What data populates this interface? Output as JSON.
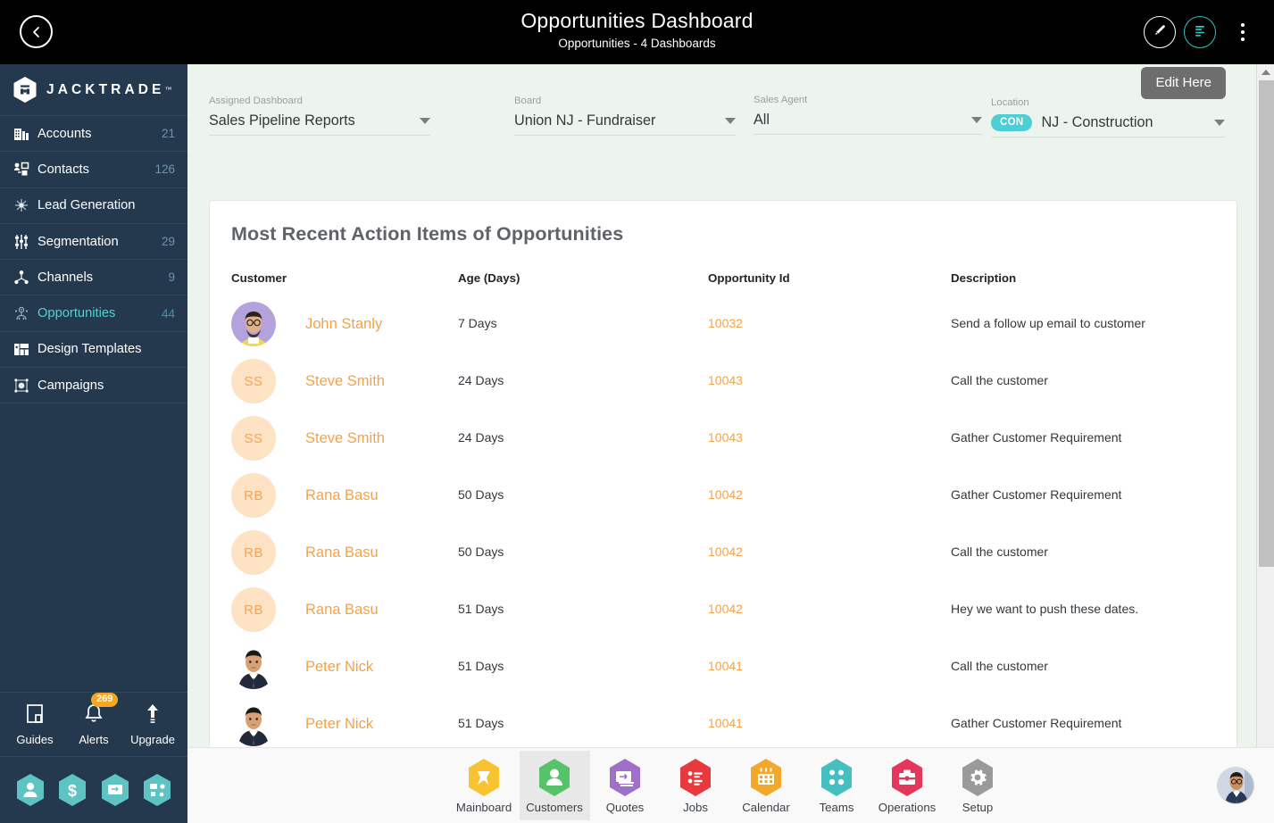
{
  "topbar": {
    "back_icon": "chevron-left-icon",
    "title": "Opportunities Dashboard",
    "subtitle": "Opportunities - 4 Dashboards",
    "edit_icon": "pencil-icon",
    "list_icon": "list-lines-icon",
    "more_icon": "kebab-menu-icon"
  },
  "sidebar": {
    "brand": "JACKTRADE",
    "brand_tm": "™",
    "items": [
      {
        "label": "Accounts",
        "count": "21",
        "icon": "building-icon",
        "active": false
      },
      {
        "label": "Contacts",
        "count": "126",
        "icon": "contacts-icon",
        "active": false
      },
      {
        "label": "Lead Generation",
        "count": "",
        "icon": "lead-gen-icon",
        "active": false
      },
      {
        "label": "Segmentation",
        "count": "29",
        "icon": "segmentation-icon",
        "active": false
      },
      {
        "label": "Channels",
        "count": "9",
        "icon": "channels-icon",
        "active": false
      },
      {
        "label": "Opportunities",
        "count": "44",
        "icon": "opportunities-icon",
        "active": true
      },
      {
        "label": "Design Templates",
        "count": "",
        "icon": "templates-icon",
        "active": false
      },
      {
        "label": "Campaigns",
        "count": "",
        "icon": "campaigns-icon",
        "active": false
      }
    ],
    "tools": [
      {
        "label": "Guides",
        "icon": "book-icon",
        "badge": ""
      },
      {
        "label": "Alerts",
        "icon": "bell-icon",
        "badge": "269"
      },
      {
        "label": "Upgrade",
        "icon": "arrow-up-icon",
        "badge": ""
      }
    ],
    "quick_hexes": [
      {
        "icon": "person-hex-icon"
      },
      {
        "icon": "dollar-hex-icon"
      },
      {
        "icon": "payment-hex-icon"
      },
      {
        "icon": "workflow-hex-icon"
      }
    ]
  },
  "filters": {
    "edit_button": "Edit Here",
    "fields": [
      {
        "label": "Assigned Dashboard",
        "value": "Sales Pipeline Reports",
        "tag": ""
      },
      {
        "label": "Board",
        "value": "Union NJ - Fundraiser",
        "tag": ""
      },
      {
        "label": "Sales Agent",
        "value": "All",
        "tag": ""
      },
      {
        "label": "Location",
        "value": "NJ - Construction",
        "tag": "CON"
      }
    ]
  },
  "card": {
    "title": "Most Recent Action Items of Opportunities",
    "columns": [
      "Customer",
      "Age (Days)",
      "Opportunity Id",
      "Description"
    ],
    "rows": [
      {
        "avatar_type": "photo",
        "avatar_kind": "man-glasses-photo",
        "initials": "",
        "name": "John Stanly",
        "age": "7 Days",
        "opportunity_id": "10032",
        "description": "Send a follow up email to customer"
      },
      {
        "avatar_type": "initials",
        "avatar_kind": "initials-avatar",
        "initials": "SS",
        "name": "Steve Smith",
        "age": "24 Days",
        "opportunity_id": "10043",
        "description": "Call the customer"
      },
      {
        "avatar_type": "initials",
        "avatar_kind": "initials-avatar",
        "initials": "SS",
        "name": "Steve Smith",
        "age": "24 Days",
        "opportunity_id": "10043",
        "description": "Gather Customer Requirement"
      },
      {
        "avatar_type": "initials",
        "avatar_kind": "initials-avatar",
        "initials": "RB",
        "name": "Rana Basu",
        "age": "50 Days",
        "opportunity_id": "10042",
        "description": "Gather Customer Requirement"
      },
      {
        "avatar_type": "initials",
        "avatar_kind": "initials-avatar",
        "initials": "RB",
        "name": "Rana Basu",
        "age": "50 Days",
        "opportunity_id": "10042",
        "description": "Call the customer"
      },
      {
        "avatar_type": "initials",
        "avatar_kind": "initials-avatar",
        "initials": "RB",
        "name": "Rana Basu",
        "age": "51 Days",
        "opportunity_id": "10042",
        "description": "Hey we want to push these dates."
      },
      {
        "avatar_type": "photo",
        "avatar_kind": "man-suit-photo",
        "initials": "",
        "name": "Peter Nick",
        "age": "51 Days",
        "opportunity_id": "10041",
        "description": "Call the customer"
      },
      {
        "avatar_type": "photo",
        "avatar_kind": "man-suit-photo",
        "initials": "",
        "name": "Peter Nick",
        "age": "51 Days",
        "opportunity_id": "10041",
        "description": "Gather Customer Requirement"
      }
    ]
  },
  "bottomnav": {
    "items": [
      {
        "label": "Mainboard",
        "icon": "mainboard-icon",
        "color": "#f7c331",
        "active": false
      },
      {
        "label": "Customers",
        "icon": "customers-icon",
        "color": "#56c36a",
        "active": true
      },
      {
        "label": "Quotes",
        "icon": "quotes-icon",
        "color": "#a06fc8",
        "active": false
      },
      {
        "label": "Jobs",
        "icon": "jobs-icon",
        "color": "#e8393f",
        "active": false
      },
      {
        "label": "Calendar",
        "icon": "calendar-icon",
        "color": "#f2a92b",
        "active": false
      },
      {
        "label": "Teams",
        "icon": "teams-icon",
        "color": "#45bfbf",
        "active": false
      },
      {
        "label": "Operations",
        "icon": "operations-icon",
        "color": "#e5365c",
        "active": false
      },
      {
        "label": "Setup",
        "icon": "setup-icon",
        "color": "#9a9a9a",
        "active": false
      }
    ],
    "avatar": "user-avatar"
  },
  "colors": {
    "topbar_bg": "#000000",
    "sidebar_bg": "#24394e",
    "accent_teal": "#4fd3d3",
    "accent_orange": "#f5a247",
    "main_bg": "#edf4ed",
    "card_bg": "#ffffff"
  }
}
